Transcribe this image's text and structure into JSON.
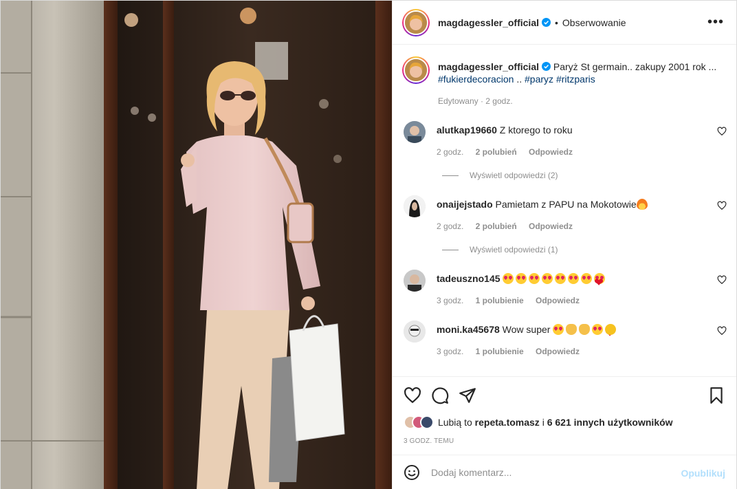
{
  "post": {
    "username": "magdagessler_official",
    "follow_label": "Obserwowanie",
    "separator": "•",
    "more_label": "•••"
  },
  "caption": {
    "username": "magdagessler_official",
    "text": "Paryż St germain.. zakupy 2001 rok ...",
    "tags": [
      "#fukierdecoracion",
      "..",
      "#paryz",
      "#ritzparis"
    ],
    "meta": "Edytowany · 2 godz."
  },
  "comments": [
    {
      "username": "alutkap19660",
      "text": "Z ktorego to roku",
      "time": "2 godz.",
      "likes": "2 polubień",
      "reply": "Odpowiedz",
      "view_replies": "Wyświetl odpowiedzi (2)",
      "emojis": []
    },
    {
      "username": "onaijejstado",
      "text": "Pamietam z PAPU na Mokotowie",
      "time": "2 godz.",
      "likes": "2 polubień",
      "reply": "Odpowiedz",
      "view_replies": "Wyświetl odpowiedzi (1)",
      "emojis": [
        "fire"
      ]
    },
    {
      "username": "tadeuszno145",
      "text": "",
      "time": "3 godz.",
      "likes": "1 polubienie",
      "reply": "Odpowiedz",
      "view_replies": "",
      "emojis": [
        "face",
        "face",
        "face",
        "face",
        "face",
        "face",
        "face",
        "face",
        "heart",
        "heart",
        "heart",
        "heart",
        "heart",
        "heart",
        "heart"
      ]
    },
    {
      "username": "moni.ka45678",
      "text": "Wow super",
      "time": "3 godz.",
      "likes": "1 polubienie",
      "reply": "Odpowiedz",
      "view_replies": "",
      "emojis": [
        "face",
        "heart",
        "clap",
        "clap",
        "face",
        "sun"
      ]
    }
  ],
  "likes": {
    "prefix": "Lubią to",
    "user": "repeta.tomasz",
    "middle": "i",
    "others": "6 621 innych użytkowników"
  },
  "timestamp": "3 GODZ. TEMU",
  "add_comment": {
    "placeholder": "Dodaj komentarz...",
    "publish_label": "Opublikuj"
  },
  "colors": {
    "link": "#00376b",
    "verified": "#0095f6",
    "publish_disabled": "#b2dffc",
    "secondary_text": "#8e8e8e"
  }
}
